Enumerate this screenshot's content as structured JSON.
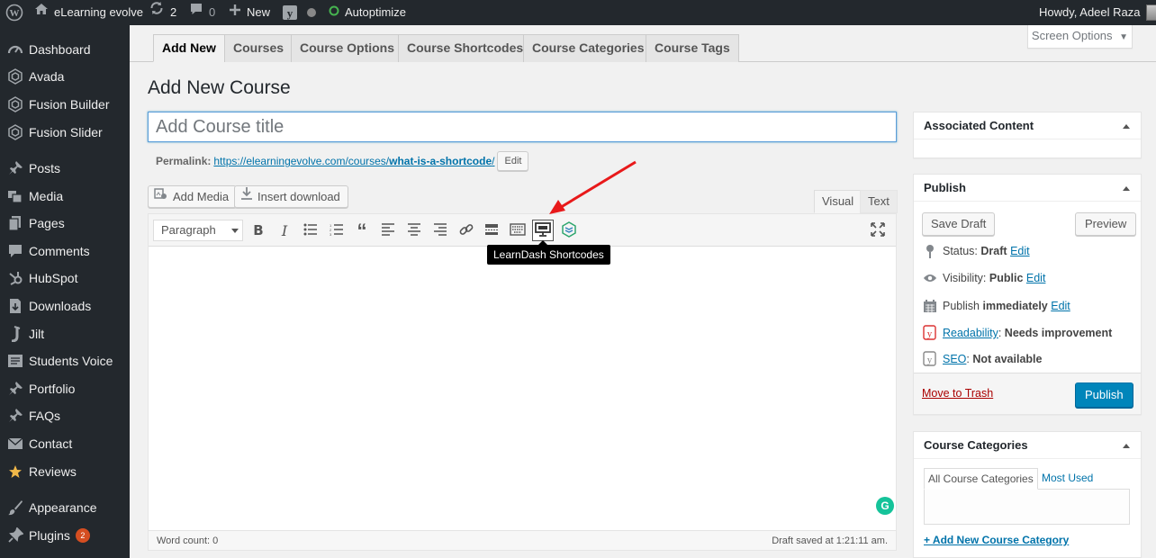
{
  "adminbar": {
    "site_name": "eLearning evolve",
    "updates_count": "2",
    "comments_count": "0",
    "new_label": "New",
    "autoptimize_label": "Autoptimize",
    "howdy": "Howdy, Adeel Raza"
  },
  "sidebar": {
    "items": [
      {
        "label": "Dashboard",
        "icon": "dashboard-icon"
      },
      {
        "label": "Avada",
        "icon": "avada-icon"
      },
      {
        "label": "Fusion Builder",
        "icon": "fusion-builder-icon"
      },
      {
        "label": "Fusion Slider",
        "icon": "fusion-slider-icon"
      },
      {
        "label": "Posts",
        "icon": "pushpin-icon"
      },
      {
        "label": "Media",
        "icon": "media-icon"
      },
      {
        "label": "Pages",
        "icon": "pages-icon"
      },
      {
        "label": "Comments",
        "icon": "comments-icon"
      },
      {
        "label": "HubSpot",
        "icon": "hubspot-icon"
      },
      {
        "label": "Downloads",
        "icon": "downloads-icon"
      },
      {
        "label": "Jilt",
        "icon": "jilt-icon"
      },
      {
        "label": "Students Voice",
        "icon": "students-voice-icon"
      },
      {
        "label": "Portfolio",
        "icon": "pushpin-icon"
      },
      {
        "label": "FAQs",
        "icon": "pushpin-icon"
      },
      {
        "label": "Contact",
        "icon": "email-icon"
      },
      {
        "label": "Reviews",
        "icon": "star-icon"
      },
      {
        "label": "Appearance",
        "icon": "brush-icon"
      },
      {
        "label": "Plugins",
        "icon": "plugins-icon",
        "badge": "2"
      }
    ]
  },
  "tabs": [
    "Add New",
    "Courses",
    "Course Options",
    "Course Shortcodes",
    "Course Categories",
    "Course Tags"
  ],
  "screen_options": "Screen Options",
  "page_title": "Add New Course",
  "title_placeholder": "Add Course title",
  "permalink": {
    "label": "Permalink:",
    "url_base": "https://elearningevolve.com/courses/",
    "slug": "what-is-a-shortcode",
    "trailing": "/",
    "edit_label": "Edit"
  },
  "media_buttons": {
    "add_media": "Add Media",
    "insert_download": "Insert download"
  },
  "editor_tabs": {
    "visual": "Visual",
    "text": "Text"
  },
  "toolbar": {
    "format": "Paragraph",
    "buttons": [
      "bold-icon",
      "italic-icon",
      "bullet-list-icon",
      "numbered-list-icon",
      "blockquote-icon",
      "align-left-icon",
      "align-center-icon",
      "align-right-icon",
      "link-icon",
      "read-more-icon",
      "keyboard-icon",
      "learndash-shortcodes-icon",
      "layers-icon",
      "fullscreen-icon"
    ],
    "tooltip": "LearnDash Shortcodes"
  },
  "status_bar": {
    "word_count": "Word count: 0",
    "draft_saved": "Draft saved at 1:21:11 am."
  },
  "associated_content": {
    "title": "Associated Content"
  },
  "publish": {
    "title": "Publish",
    "save_draft": "Save Draft",
    "preview": "Preview",
    "status_label": "Status:",
    "status_value": "Draft",
    "visibility_label": "Visibility:",
    "visibility_value": "Public",
    "publish_label": "Publish",
    "publish_value": "immediately",
    "edit": "Edit",
    "readability_link": "Readability",
    "readability_value": "Needs improvement",
    "seo_link": "SEO",
    "seo_value": "Not available",
    "trash": "Move to Trash",
    "publish_button": "Publish",
    "colors": {
      "primary": "#0085ba",
      "trash": "#a00",
      "readability_bad": "#dc3232"
    }
  },
  "course_categories": {
    "title": "Course Categories",
    "tab_all": "All Course Categories",
    "tab_most_used": "Most Used",
    "add_new": "+ Add New Course Category"
  }
}
